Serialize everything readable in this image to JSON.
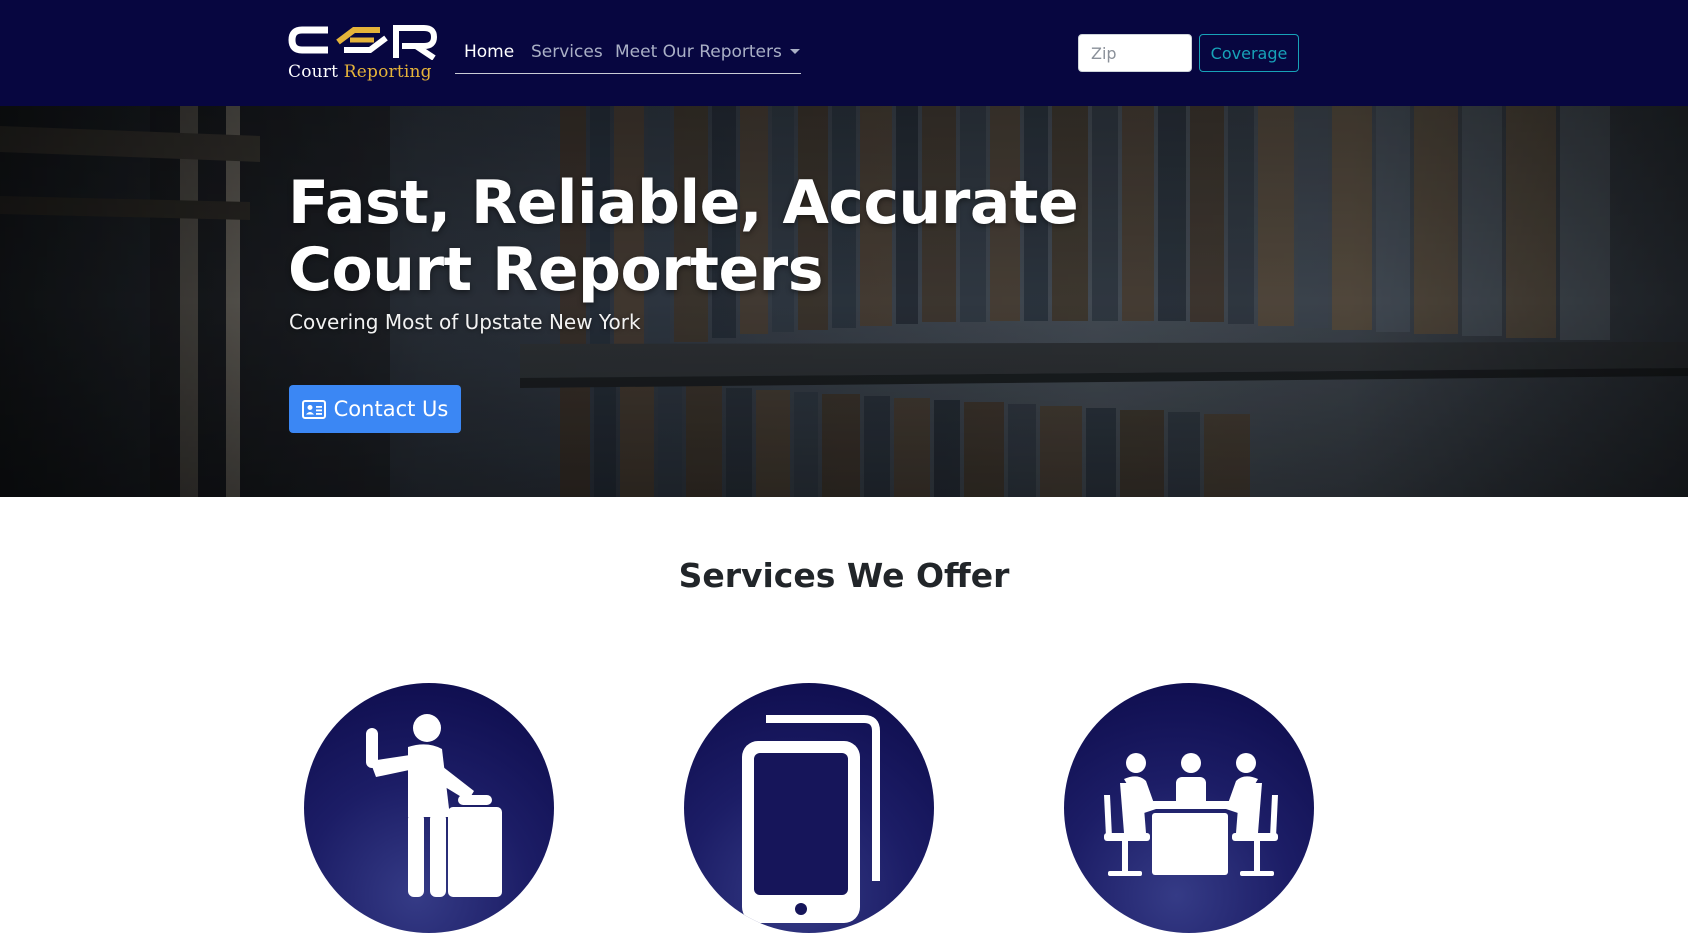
{
  "header": {
    "logo": {
      "mark": "CSR",
      "text_part1": "Court",
      "text_part2": "Reporting"
    },
    "nav": [
      {
        "label": "Home",
        "active": true
      },
      {
        "label": "Services",
        "active": false
      },
      {
        "label": "Meet Our Reporters",
        "active": false,
        "dropdown": true
      }
    ],
    "zip_placeholder": "Zip",
    "coverage_label": "Coverage"
  },
  "hero": {
    "title": "Fast, Reliable, Accurate Court Reporters",
    "subtitle": "Covering Most of Upstate New York",
    "cta_label": "Contact Us",
    "cta_icon": "address-card-icon"
  },
  "services": {
    "heading": "Services We Offer",
    "items": [
      {
        "icon": "witness-stand-icon"
      },
      {
        "icon": "tablet-icon"
      },
      {
        "icon": "conference-table-icon"
      }
    ]
  },
  "colors": {
    "navbar_bg": "#070640",
    "accent_gold": "#e5b33a",
    "cta_blue": "#3b87f4",
    "coverage_teal": "#17a2b8",
    "circle_navy": "#1c1d66"
  }
}
